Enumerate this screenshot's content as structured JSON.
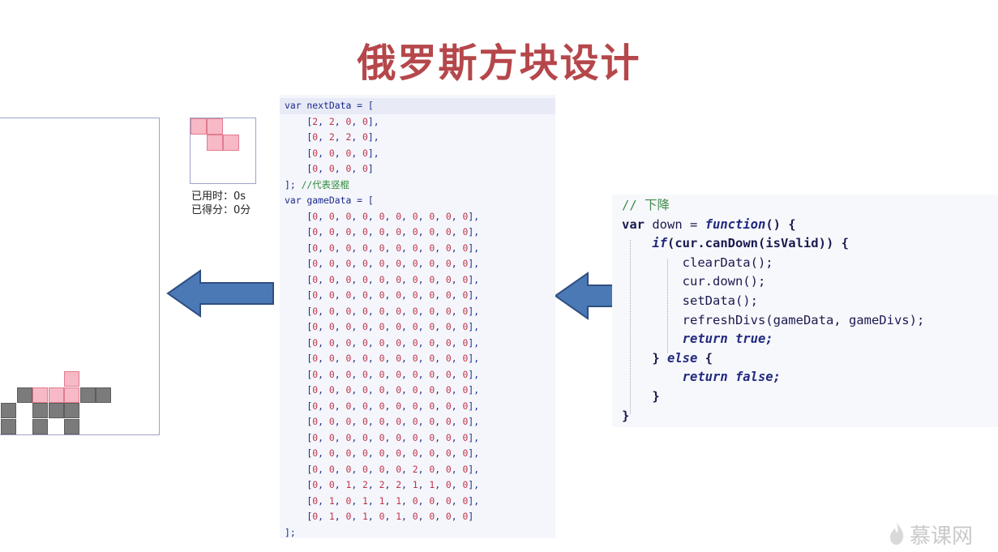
{
  "title": "俄罗斯方块设计",
  "stats": {
    "time_label": "已用时：0s",
    "score_label": "已得分：0分"
  },
  "code_panel": {
    "lines": [
      "var nextData = [",
      "    [2, 2, 0, 0],",
      "    [0, 2, 2, 0],",
      "    [0, 0, 0, 0],",
      "    [0, 0, 0, 0]",
      "]; //代表竖棍",
      "var gameData = [",
      "    [0, 0, 0, 0, 0, 0, 0, 0, 0, 0],",
      "    [0, 0, 0, 0, 0, 0, 0, 0, 0, 0],",
      "    [0, 0, 0, 0, 0, 0, 0, 0, 0, 0],",
      "    [0, 0, 0, 0, 0, 0, 0, 0, 0, 0],",
      "    [0, 0, 0, 0, 0, 0, 0, 0, 0, 0],",
      "    [0, 0, 0, 0, 0, 0, 0, 0, 0, 0],",
      "    [0, 0, 0, 0, 0, 0, 0, 0, 0, 0],",
      "    [0, 0, 0, 0, 0, 0, 0, 0, 0, 0],",
      "    [0, 0, 0, 0, 0, 0, 0, 0, 0, 0],",
      "    [0, 0, 0, 0, 0, 0, 0, 0, 0, 0],",
      "    [0, 0, 0, 0, 0, 0, 0, 0, 0, 0],",
      "    [0, 0, 0, 0, 0, 0, 0, 0, 0, 0],",
      "    [0, 0, 0, 0, 0, 0, 0, 0, 0, 0],",
      "    [0, 0, 0, 0, 0, 0, 0, 0, 0, 0],",
      "    [0, 0, 0, 0, 0, 0, 0, 0, 0, 0],",
      "    [0, 0, 0, 0, 0, 0, 0, 0, 0, 0],",
      "    [0, 0, 0, 0, 0, 0, 2, 0, 0, 0],",
      "    [0, 0, 1, 2, 2, 2, 1, 1, 0, 0],",
      "    [0, 1, 0, 1, 1, 1, 0, 0, 0, 0],",
      "    [0, 1, 0, 1, 0, 1, 0, 0, 0, 0]",
      "];"
    ]
  },
  "fn_panel": {
    "comment": "// 下降",
    "l1_kw": "var",
    "l1_rest": " down = ",
    "l1_fn": "function",
    "l1_end": "() {",
    "l2_kw": "if",
    "l2_rest": "(cur.canDown(isValid)) {",
    "l3": "clearData();",
    "l4": "cur.down();",
    "l5": "setData();",
    "l6": "refreshDivs(gameData, gameDivs);",
    "l7": "return true;",
    "l8_a": "} ",
    "l8_b": "else",
    "l8_c": " {",
    "l9": "return false;",
    "l10": "}",
    "l11": "}"
  },
  "board": {
    "rows": 20,
    "cols": 10,
    "visible_bottom_rows": [
      [
        0,
        0,
        0,
        0,
        2,
        0,
        0,
        0,
        0,
        0
      ],
      [
        0,
        1,
        2,
        2,
        2,
        1,
        1,
        0,
        0,
        0
      ],
      [
        1,
        0,
        1,
        1,
        1,
        0,
        0,
        0,
        0,
        0
      ],
      [
        1,
        0,
        1,
        0,
        1,
        0,
        0,
        0,
        0,
        0
      ]
    ]
  },
  "next": [
    [
      2,
      2,
      0,
      0
    ],
    [
      0,
      2,
      2,
      0
    ],
    [
      0,
      0,
      0,
      0
    ],
    [
      0,
      0,
      0,
      0
    ]
  ],
  "logo_text": "慕课网",
  "colors": {
    "title": "#b5474b",
    "arrow_fill": "#4b79b6",
    "arrow_stroke": "#2f4f80",
    "block_fixed": "#7b7b7b",
    "block_current": "#f7b9c6"
  }
}
